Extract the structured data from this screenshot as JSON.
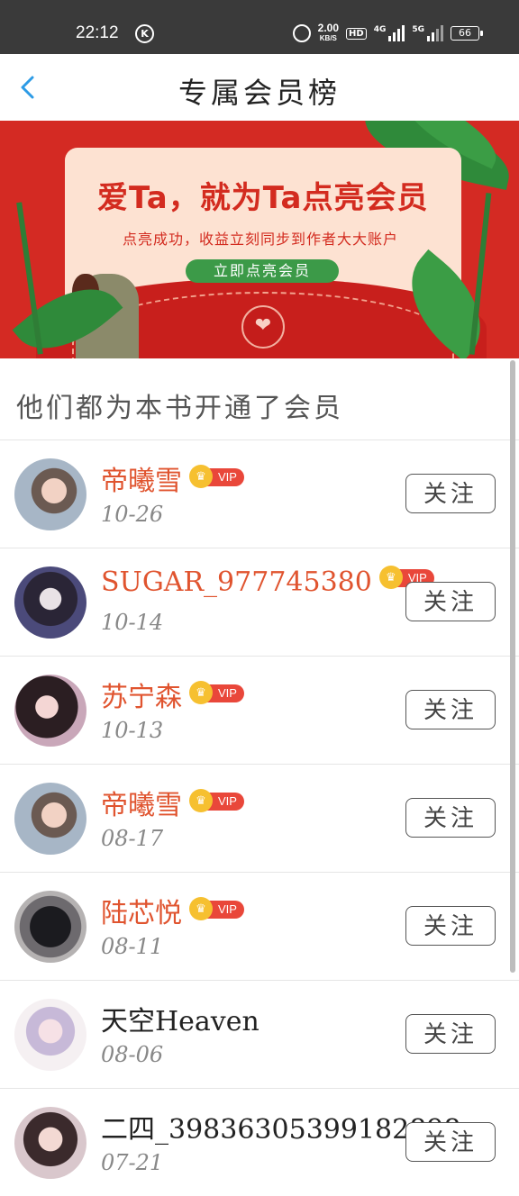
{
  "status_bar": {
    "time": "22:12",
    "k_icon": "K",
    "speed_value": "2.00",
    "speed_unit": "KB/S",
    "hd_label": "HD",
    "signal1_label": "4G",
    "signal2_label": "5G",
    "battery": "66"
  },
  "header": {
    "title": "专属会员榜",
    "back_icon": "chevron-left-icon"
  },
  "banner": {
    "slogan": "爱Ta，就为Ta点亮会员",
    "subtitle": "点亮成功，收益立刻同步到作者大大账户",
    "cta": "立即点亮会员",
    "heart_icon": "❤"
  },
  "section": {
    "title": "他们都为本书开通了会员"
  },
  "vip_label": "VIP",
  "follow_label": "关注",
  "colors": {
    "accent_orange": "#e0542f",
    "vip_badge": "#e9473a",
    "banner_red": "#d42a23",
    "cta_green": "#3c9a48"
  },
  "members": [
    {
      "name": "帝曦雪",
      "date": "10-26",
      "vip": true
    },
    {
      "name": "SUGAR_977745380",
      "date": "10-14",
      "vip": true
    },
    {
      "name": "苏宁森",
      "date": "10-13",
      "vip": true
    },
    {
      "name": "帝曦雪",
      "date": "08-17",
      "vip": true
    },
    {
      "name": "陆芯悦",
      "date": "08-11",
      "vip": true
    },
    {
      "name": "天空Heaven",
      "date": "08-06",
      "vip": false
    },
    {
      "name": "二四_39836305399182898",
      "date": "07-21",
      "vip": false
    }
  ]
}
